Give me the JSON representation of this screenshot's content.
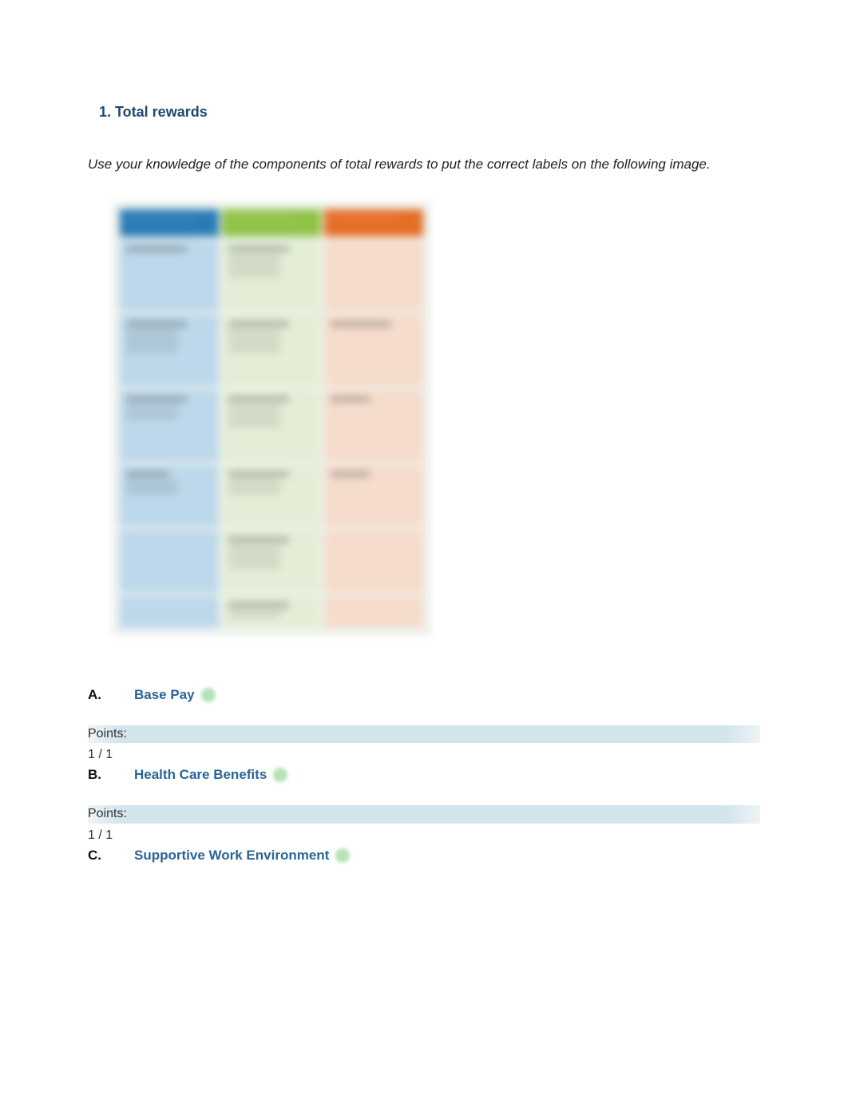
{
  "question": {
    "title": "1. Total rewards",
    "instructions": "Use your knowledge of the components of total rewards to put the correct labels on the following image."
  },
  "answers": [
    {
      "label": "A.",
      "text": "Base Pay",
      "points_label": "Points:",
      "points_value": "1 / 1"
    },
    {
      "label": "B.",
      "text": "Health Care Benefits",
      "points_label": "Points:",
      "points_value": "1 / 1"
    },
    {
      "label": "C.",
      "text": "Supportive Work Environment",
      "points_label": "",
      "points_value": ""
    }
  ]
}
